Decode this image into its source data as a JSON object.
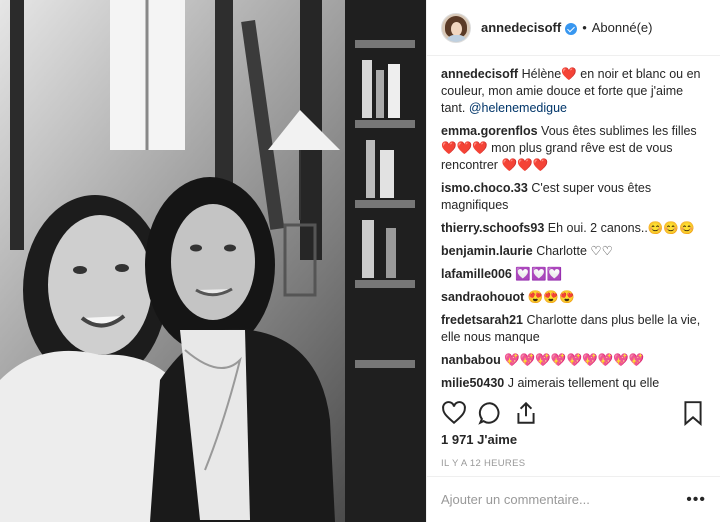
{
  "header": {
    "username": "annedecisoff",
    "separator": "•",
    "follow_status": "Abonné(e)"
  },
  "comments": [
    {
      "user": "annedecisoff",
      "text": "Hélène❤️ en noir et blanc ou en couleur, mon amie douce et forte que j'aime tant.",
      "mention": "@helenemedigue"
    },
    {
      "user": "emma.gorenflos",
      "text": "Vous êtes sublimes les filles ❤️❤️❤️ mon plus grand rêve est de vous rencontrer ❤️❤️❤️"
    },
    {
      "user": "ismo.choco.33",
      "text": "C'est super vous êtes magnifiques"
    },
    {
      "user": "thierry.schoofs93",
      "text": "Eh oui. 2 canons..😊😊😊"
    },
    {
      "user": "benjamin.laurie",
      "text": "Charlotte ♡♡"
    },
    {
      "user": "lafamille006",
      "text": "💟💟💟"
    },
    {
      "user": "sandraohouot",
      "text": "😍😍😍"
    },
    {
      "user": "fredetsarah21",
      "text": "Charlotte dans plus belle la vie, elle nous manque"
    },
    {
      "user": "nanbabou",
      "text": "💖💖💖💖💖💖💖💖💖"
    },
    {
      "user": "milie50430",
      "text": "J aimerais tellement qu elle"
    }
  ],
  "likes": "1 971 J'aime",
  "timestamp": "IL Y A 12 HEURES",
  "add_comment": {
    "placeholder": "Ajouter un commentaire...",
    "more": "•••"
  },
  "colors": {
    "verified": "#3897f0",
    "mention": "#003569",
    "meta": "#999999"
  },
  "icons": {
    "like": "heart-outline-icon",
    "comment": "speech-bubble-icon",
    "share": "share-icon",
    "save": "bookmark-icon",
    "verified": "verified-badge-icon"
  }
}
